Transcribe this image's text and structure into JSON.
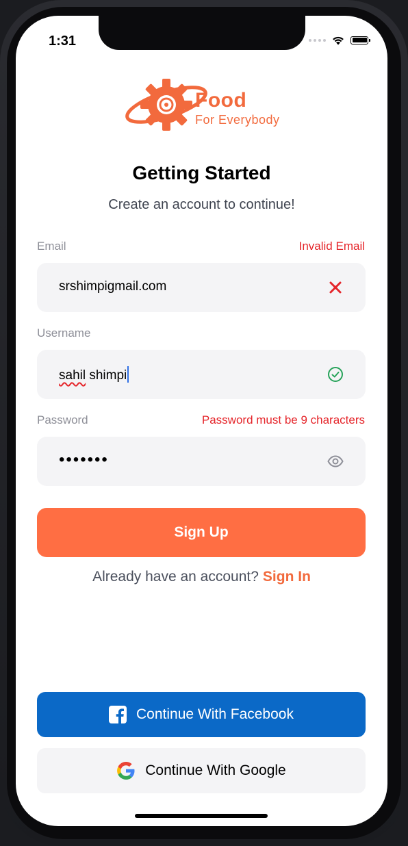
{
  "status_bar": {
    "time": "1:31",
    "icons": [
      "cellular-dots-icon",
      "wifi-icon",
      "battery-icon"
    ]
  },
  "brand": {
    "name": "Food",
    "tagline": "For Everybody",
    "color": "#f26a3d"
  },
  "header": {
    "title": "Getting Started",
    "subtitle": "Create an account to continue!"
  },
  "form": {
    "email": {
      "label": "Email",
      "error": "Invalid Email",
      "value": "srshimpigmail.com",
      "status_icon": "close-icon"
    },
    "username": {
      "label": "Username",
      "value_misspelled": "sahil",
      "value_rest": " shimpi",
      "status_icon": "check-circle-icon"
    },
    "password": {
      "label": "Password",
      "error": "Password must be 9 characters",
      "masked_value": "•••••••",
      "status_icon": "eye-icon"
    },
    "submit_label": "Sign Up"
  },
  "signin": {
    "prompt": "Already have an account?",
    "link": "Sign In"
  },
  "social": {
    "facebook_label": "Continue With Facebook",
    "google_label": "Continue With Google"
  },
  "colors": {
    "accent": "#ff6e43",
    "error": "#e5252a",
    "success": "#27a35a",
    "facebook": "#0b69c7",
    "field_bg": "#f4f4f6"
  }
}
